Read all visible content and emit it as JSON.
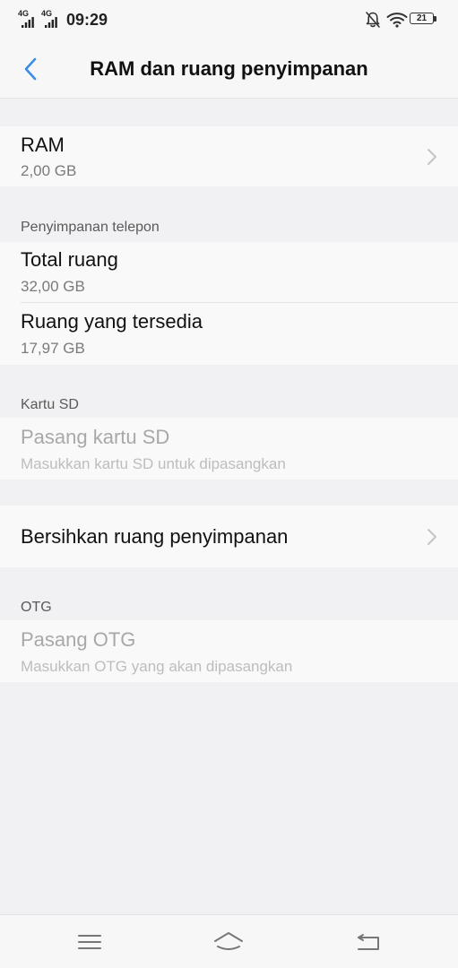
{
  "status_bar": {
    "network_1": "4G",
    "network_2": "4G",
    "time": "09:29",
    "battery": "21"
  },
  "header": {
    "title": "RAM dan ruang penyimpanan"
  },
  "ram": {
    "title": "RAM",
    "value": "2,00 GB"
  },
  "phone_storage": {
    "header": "Penyimpanan telepon",
    "total": {
      "title": "Total ruang",
      "value": "32,00 GB"
    },
    "available": {
      "title": "Ruang yang tersedia",
      "value": "17,97 GB"
    }
  },
  "sd_card": {
    "header": "Kartu SD",
    "title": "Pasang kartu SD",
    "subtitle": "Masukkan kartu SD untuk dipasangkan"
  },
  "clean": {
    "title": "Bersihkan ruang penyimpanan"
  },
  "otg": {
    "header": "OTG",
    "title": "Pasang OTG",
    "subtitle": "Masukkan OTG yang akan dipasangkan"
  },
  "icons": {
    "back": "chevron-left-icon",
    "chevron": "chevron-right-icon",
    "menu": "menu-icon",
    "home": "home-icon",
    "back_nav": "back-icon"
  },
  "colors": {
    "accent": "#3a8ee6",
    "background": "#f1f1f3",
    "card": "#f9f9fa"
  }
}
